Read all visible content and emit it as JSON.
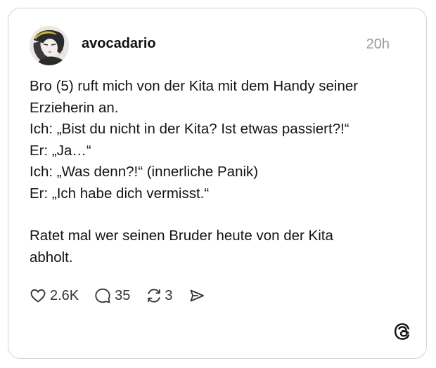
{
  "post": {
    "author": {
      "username": "avocadario",
      "avatar_icon": "profile-photo"
    },
    "timestamp": "20h",
    "lines": [
      "Bro (5) ruft mich von der Kita mit dem Handy seiner",
      "Erzieherin an.",
      "Ich: „Bist du nicht in der Kita? Ist etwas passiert?!“",
      "Er: „Ja…“",
      "Ich: „Was denn?!“ (innerliche Panik)",
      "Er: „Ich habe dich vermisst.“",
      "Ratet mal wer seinen Bruder heute von der Kita",
      "abholt."
    ],
    "actions": {
      "likes": "2.6K",
      "replies": "35",
      "reposts": "3",
      "like_icon": "heart-icon",
      "reply_icon": "speech-bubble-icon",
      "repost_icon": "repost-icon",
      "share_icon": "send-icon"
    }
  },
  "brand": {
    "logo_icon": "threads-logo-icon"
  },
  "colors": {
    "border": "#d4d4d4",
    "text": "#151515",
    "muted": "#9a9a9a"
  }
}
